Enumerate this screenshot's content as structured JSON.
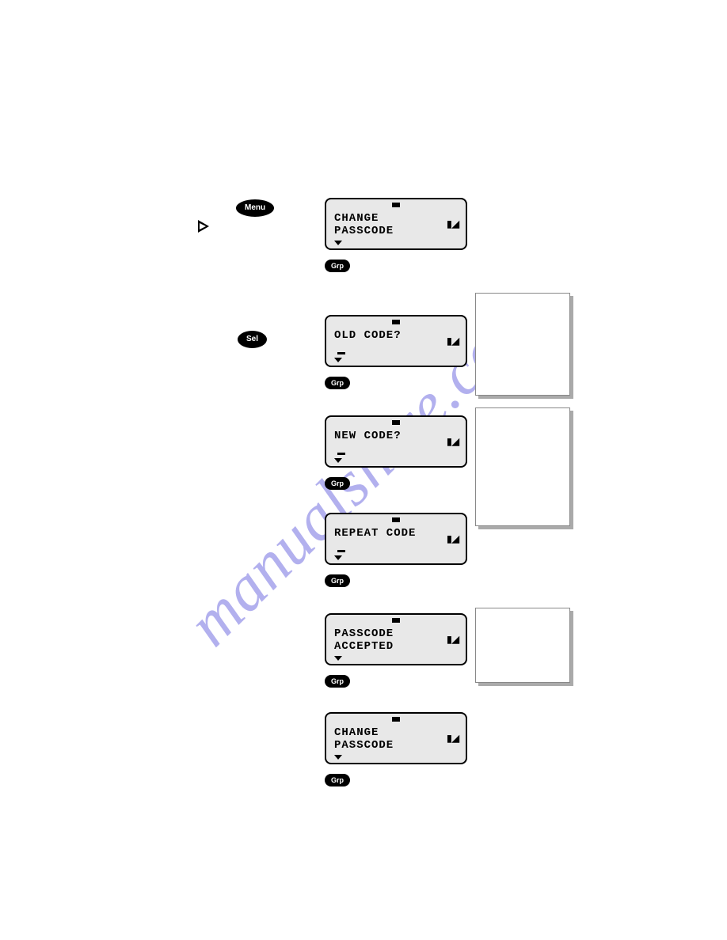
{
  "watermark": "manualshive.com",
  "buttons": {
    "menu": "Menu",
    "sel": "Sel",
    "grp": "Grp"
  },
  "signal_glyph": "▮◢",
  "screens": [
    {
      "text": "CHANGE\nPASSCODE",
      "cursor": false
    },
    {
      "text": "OLD CODE?",
      "cursor": true
    },
    {
      "text": "NEW CODE?",
      "cursor": true
    },
    {
      "text": "REPEAT CODE",
      "cursor": true
    },
    {
      "text": "PASSCODE\nACCEPTED",
      "cursor": false
    },
    {
      "text": "CHANGE\nPASSCODE",
      "cursor": false
    }
  ]
}
